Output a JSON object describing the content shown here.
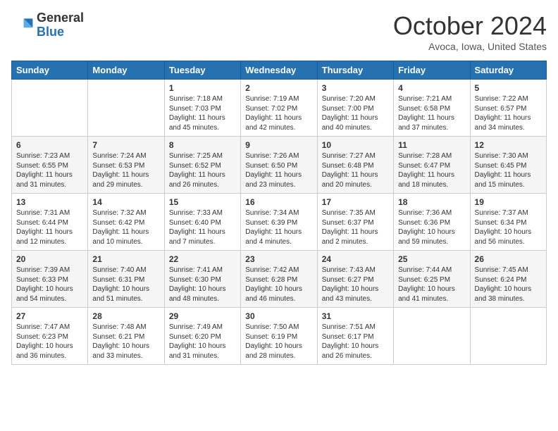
{
  "header": {
    "logo_general": "General",
    "logo_blue": "Blue",
    "month_title": "October 2024",
    "location": "Avoca, Iowa, United States"
  },
  "weekdays": [
    "Sunday",
    "Monday",
    "Tuesday",
    "Wednesday",
    "Thursday",
    "Friday",
    "Saturday"
  ],
  "weeks": [
    [
      {
        "day": null
      },
      {
        "day": null
      },
      {
        "day": "1",
        "sunrise": "Sunrise: 7:18 AM",
        "sunset": "Sunset: 7:03 PM",
        "daylight": "Daylight: 11 hours and 45 minutes."
      },
      {
        "day": "2",
        "sunrise": "Sunrise: 7:19 AM",
        "sunset": "Sunset: 7:02 PM",
        "daylight": "Daylight: 11 hours and 42 minutes."
      },
      {
        "day": "3",
        "sunrise": "Sunrise: 7:20 AM",
        "sunset": "Sunset: 7:00 PM",
        "daylight": "Daylight: 11 hours and 40 minutes."
      },
      {
        "day": "4",
        "sunrise": "Sunrise: 7:21 AM",
        "sunset": "Sunset: 6:58 PM",
        "daylight": "Daylight: 11 hours and 37 minutes."
      },
      {
        "day": "5",
        "sunrise": "Sunrise: 7:22 AM",
        "sunset": "Sunset: 6:57 PM",
        "daylight": "Daylight: 11 hours and 34 minutes."
      }
    ],
    [
      {
        "day": "6",
        "sunrise": "Sunrise: 7:23 AM",
        "sunset": "Sunset: 6:55 PM",
        "daylight": "Daylight: 11 hours and 31 minutes."
      },
      {
        "day": "7",
        "sunrise": "Sunrise: 7:24 AM",
        "sunset": "Sunset: 6:53 PM",
        "daylight": "Daylight: 11 hours and 29 minutes."
      },
      {
        "day": "8",
        "sunrise": "Sunrise: 7:25 AM",
        "sunset": "Sunset: 6:52 PM",
        "daylight": "Daylight: 11 hours and 26 minutes."
      },
      {
        "day": "9",
        "sunrise": "Sunrise: 7:26 AM",
        "sunset": "Sunset: 6:50 PM",
        "daylight": "Daylight: 11 hours and 23 minutes."
      },
      {
        "day": "10",
        "sunrise": "Sunrise: 7:27 AM",
        "sunset": "Sunset: 6:48 PM",
        "daylight": "Daylight: 11 hours and 20 minutes."
      },
      {
        "day": "11",
        "sunrise": "Sunrise: 7:28 AM",
        "sunset": "Sunset: 6:47 PM",
        "daylight": "Daylight: 11 hours and 18 minutes."
      },
      {
        "day": "12",
        "sunrise": "Sunrise: 7:30 AM",
        "sunset": "Sunset: 6:45 PM",
        "daylight": "Daylight: 11 hours and 15 minutes."
      }
    ],
    [
      {
        "day": "13",
        "sunrise": "Sunrise: 7:31 AM",
        "sunset": "Sunset: 6:44 PM",
        "daylight": "Daylight: 11 hours and 12 minutes."
      },
      {
        "day": "14",
        "sunrise": "Sunrise: 7:32 AM",
        "sunset": "Sunset: 6:42 PM",
        "daylight": "Daylight: 11 hours and 10 minutes."
      },
      {
        "day": "15",
        "sunrise": "Sunrise: 7:33 AM",
        "sunset": "Sunset: 6:40 PM",
        "daylight": "Daylight: 11 hours and 7 minutes."
      },
      {
        "day": "16",
        "sunrise": "Sunrise: 7:34 AM",
        "sunset": "Sunset: 6:39 PM",
        "daylight": "Daylight: 11 hours and 4 minutes."
      },
      {
        "day": "17",
        "sunrise": "Sunrise: 7:35 AM",
        "sunset": "Sunset: 6:37 PM",
        "daylight": "Daylight: 11 hours and 2 minutes."
      },
      {
        "day": "18",
        "sunrise": "Sunrise: 7:36 AM",
        "sunset": "Sunset: 6:36 PM",
        "daylight": "Daylight: 10 hours and 59 minutes."
      },
      {
        "day": "19",
        "sunrise": "Sunrise: 7:37 AM",
        "sunset": "Sunset: 6:34 PM",
        "daylight": "Daylight: 10 hours and 56 minutes."
      }
    ],
    [
      {
        "day": "20",
        "sunrise": "Sunrise: 7:39 AM",
        "sunset": "Sunset: 6:33 PM",
        "daylight": "Daylight: 10 hours and 54 minutes."
      },
      {
        "day": "21",
        "sunrise": "Sunrise: 7:40 AM",
        "sunset": "Sunset: 6:31 PM",
        "daylight": "Daylight: 10 hours and 51 minutes."
      },
      {
        "day": "22",
        "sunrise": "Sunrise: 7:41 AM",
        "sunset": "Sunset: 6:30 PM",
        "daylight": "Daylight: 10 hours and 48 minutes."
      },
      {
        "day": "23",
        "sunrise": "Sunrise: 7:42 AM",
        "sunset": "Sunset: 6:28 PM",
        "daylight": "Daylight: 10 hours and 46 minutes."
      },
      {
        "day": "24",
        "sunrise": "Sunrise: 7:43 AM",
        "sunset": "Sunset: 6:27 PM",
        "daylight": "Daylight: 10 hours and 43 minutes."
      },
      {
        "day": "25",
        "sunrise": "Sunrise: 7:44 AM",
        "sunset": "Sunset: 6:25 PM",
        "daylight": "Daylight: 10 hours and 41 minutes."
      },
      {
        "day": "26",
        "sunrise": "Sunrise: 7:45 AM",
        "sunset": "Sunset: 6:24 PM",
        "daylight": "Daylight: 10 hours and 38 minutes."
      }
    ],
    [
      {
        "day": "27",
        "sunrise": "Sunrise: 7:47 AM",
        "sunset": "Sunset: 6:23 PM",
        "daylight": "Daylight: 10 hours and 36 minutes."
      },
      {
        "day": "28",
        "sunrise": "Sunrise: 7:48 AM",
        "sunset": "Sunset: 6:21 PM",
        "daylight": "Daylight: 10 hours and 33 minutes."
      },
      {
        "day": "29",
        "sunrise": "Sunrise: 7:49 AM",
        "sunset": "Sunset: 6:20 PM",
        "daylight": "Daylight: 10 hours and 31 minutes."
      },
      {
        "day": "30",
        "sunrise": "Sunrise: 7:50 AM",
        "sunset": "Sunset: 6:19 PM",
        "daylight": "Daylight: 10 hours and 28 minutes."
      },
      {
        "day": "31",
        "sunrise": "Sunrise: 7:51 AM",
        "sunset": "Sunset: 6:17 PM",
        "daylight": "Daylight: 10 hours and 26 minutes."
      },
      {
        "day": null
      },
      {
        "day": null
      }
    ]
  ]
}
